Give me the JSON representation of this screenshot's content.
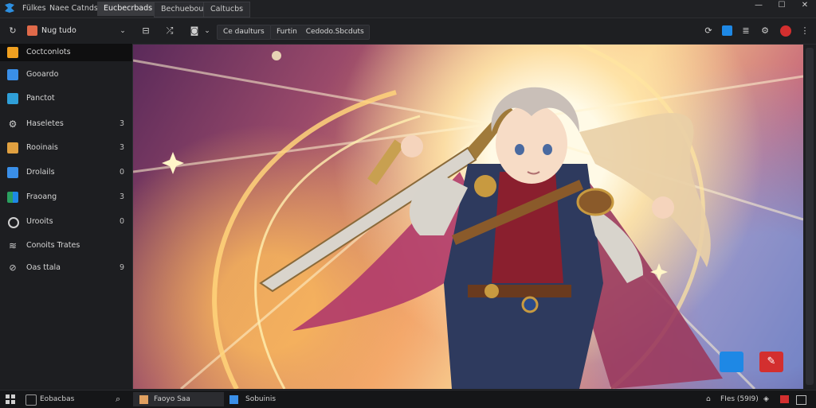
{
  "titlebar": {
    "tabs": [
      {
        "label": "Fülkes"
      },
      {
        "label": "Naee Catnds"
      },
      {
        "label": "Eucbecrbads"
      },
      {
        "label": "Bechueboue"
      },
      {
        "label": "Caltucbs"
      }
    ],
    "window_controls": {
      "minimize": "—",
      "maximize": "☐",
      "close": "✕"
    }
  },
  "toolbar": {
    "account_label": "Nug tudo",
    "pill1": "Ce daulturs",
    "pill2_a": "Furtin",
    "pill2_b": "Cedodo.Sbcduts"
  },
  "sidebar": {
    "items": [
      {
        "label": "Coctconlots",
        "count": "",
        "color": "#f0a020"
      },
      {
        "label": "Gooardo",
        "count": "",
        "color": "#3a8fe8"
      },
      {
        "label": "Panctot",
        "count": "",
        "color": "#2f9fd8"
      },
      {
        "label": "Haseletes",
        "count": "3",
        "color": "#cfcfcf"
      },
      {
        "label": "Rooinais",
        "count": "3",
        "color": "#e0a040"
      },
      {
        "label": "Drolails",
        "count": "0",
        "color": "#3a8fe8"
      },
      {
        "label": "Fraoang",
        "count": "3",
        "color": "#2aa060"
      },
      {
        "label": "Urooits",
        "count": "0",
        "color": "#d0d0d0"
      },
      {
        "label": "Conoits Trates",
        "count": "",
        "color": "#d0d0d0"
      },
      {
        "label": "Oas ttala",
        "count": "9",
        "color": "#cfcfcf"
      }
    ]
  },
  "taskbar": {
    "search_label": "Eobacbas",
    "task1": "Faoyo Saa",
    "task2": "Sobuinis",
    "tray_text": "FIes (59I9)"
  },
  "colors": {
    "accent_blue": "#1e88e5",
    "accent_red": "#d32f2f"
  }
}
